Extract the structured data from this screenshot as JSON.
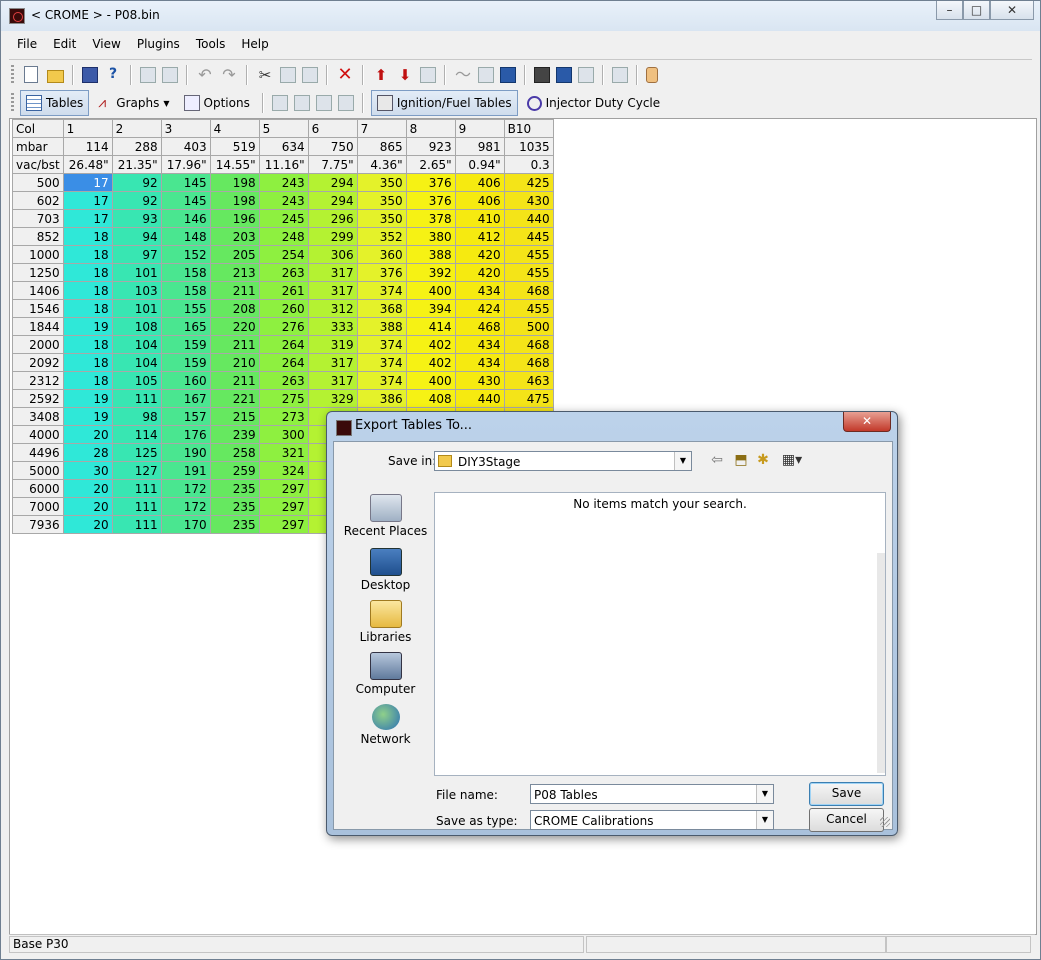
{
  "window": {
    "title": "< CROME > - P08.bin",
    "minimize": "–",
    "maximize": "□",
    "close": "✕"
  },
  "menu": [
    "File",
    "Edit",
    "View",
    "Plugins",
    "Tools",
    "Help"
  ],
  "toolbar2": {
    "tables": "Tables",
    "graphs": "Graphs",
    "options": "Options",
    "ignition_fuel": "Ignition/Fuel Tables",
    "injector_duty": "Injector Duty Cycle"
  },
  "table": {
    "columns": [
      "Col",
      "1",
      "2",
      "3",
      "4",
      "5",
      "6",
      "7",
      "8",
      "9",
      "B10"
    ],
    "mbar": [
      "mbar",
      "114",
      "288",
      "403",
      "519",
      "634",
      "750",
      "865",
      "923",
      "981",
      "1035"
    ],
    "vacbst": [
      "vac/bst",
      "26.48\"",
      "21.35\"",
      "17.96\"",
      "14.55\"",
      "11.16\"",
      "7.75\"",
      "4.36\"",
      "2.65\"",
      "0.94\"",
      "0.3"
    ],
    "rows": [
      [
        "500",
        "17",
        "92",
        "145",
        "198",
        "243",
        "294",
        "350",
        "376",
        "406",
        "425"
      ],
      [
        "602",
        "17",
        "92",
        "145",
        "198",
        "243",
        "294",
        "350",
        "376",
        "406",
        "430"
      ],
      [
        "703",
        "17",
        "93",
        "146",
        "196",
        "245",
        "296",
        "350",
        "378",
        "410",
        "440"
      ],
      [
        "852",
        "18",
        "94",
        "148",
        "203",
        "248",
        "299",
        "352",
        "380",
        "412",
        "445"
      ],
      [
        "1000",
        "18",
        "97",
        "152",
        "205",
        "254",
        "306",
        "360",
        "388",
        "420",
        "455"
      ],
      [
        "1250",
        "18",
        "101",
        "158",
        "213",
        "263",
        "317",
        "376",
        "392",
        "420",
        "455"
      ],
      [
        "1406",
        "18",
        "103",
        "158",
        "211",
        "261",
        "317",
        "374",
        "400",
        "434",
        "468"
      ],
      [
        "1546",
        "18",
        "101",
        "155",
        "208",
        "260",
        "312",
        "368",
        "394",
        "424",
        "455"
      ],
      [
        "1844",
        "19",
        "108",
        "165",
        "220",
        "276",
        "333",
        "388",
        "414",
        "468",
        "500"
      ],
      [
        "2000",
        "18",
        "104",
        "159",
        "211",
        "264",
        "319",
        "374",
        "402",
        "434",
        "468"
      ],
      [
        "2092",
        "18",
        "104",
        "159",
        "210",
        "264",
        "317",
        "374",
        "402",
        "434",
        "468"
      ],
      [
        "2312",
        "18",
        "105",
        "160",
        "211",
        "263",
        "317",
        "374",
        "400",
        "430",
        "463"
      ],
      [
        "2592",
        "19",
        "111",
        "167",
        "221",
        "275",
        "329",
        "386",
        "408",
        "440",
        "475"
      ],
      [
        "3408",
        "19",
        "98",
        "157",
        "215",
        "273",
        "",
        "",
        "",
        "",
        ""
      ],
      [
        "4000",
        "20",
        "114",
        "176",
        "239",
        "300",
        "",
        "",
        "",
        "",
        ""
      ],
      [
        "4496",
        "28",
        "125",
        "190",
        "258",
        "321",
        "",
        "",
        "",
        "",
        ""
      ],
      [
        "5000",
        "30",
        "127",
        "191",
        "259",
        "324",
        "",
        "",
        "",
        "",
        ""
      ],
      [
        "6000",
        "20",
        "111",
        "172",
        "235",
        "297",
        "",
        "",
        "",
        "",
        ""
      ],
      [
        "7000",
        "20",
        "111",
        "172",
        "235",
        "297",
        "",
        "",
        "",
        "",
        ""
      ],
      [
        "7936",
        "20",
        "111",
        "170",
        "235",
        "297",
        "",
        "",
        "",
        "",
        ""
      ]
    ],
    "column_colors": [
      "#2fe8d8",
      "#38e6b2",
      "#4ae690",
      "#66e860",
      "#8ef040",
      "#b4f232",
      "#e4f22a",
      "#f6f214",
      "#f6ea10",
      "#f4e418"
    ]
  },
  "status": {
    "left": "Base P30"
  },
  "dialog": {
    "title": "Export Tables To...",
    "close": "✕",
    "save_in_label": "Save in:",
    "save_in_value": "DIY3Stage",
    "empty_message": "No items match your search.",
    "places": [
      "Recent Places",
      "Desktop",
      "Libraries",
      "Computer",
      "Network"
    ],
    "file_name_label": "File name:",
    "file_name_value": "P08 Tables",
    "save_as_type_label": "Save as type:",
    "save_as_type_value": "CROME Calibrations",
    "save_button": "Save",
    "cancel_button": "Cancel"
  }
}
